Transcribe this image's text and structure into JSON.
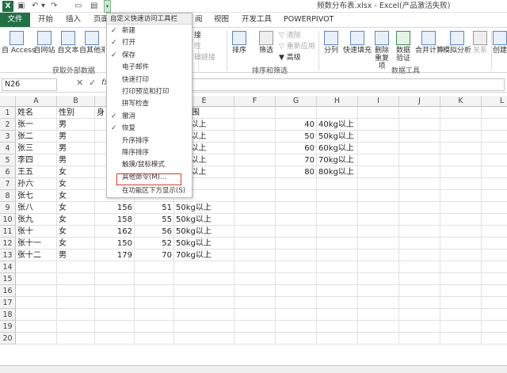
{
  "title_bar": {
    "logo": "X",
    "window_title": "频数分布表.xlsx - Excel(产品激活失败)",
    "qat_dropdown_glyph": "▾"
  },
  "tabs": [
    "文件",
    "开始",
    "插入",
    "页面",
    "阅",
    "视图",
    "开发工具",
    "POWERPIVOT"
  ],
  "ribbon": {
    "get_external": {
      "buttons": [
        "自 Access",
        "自网站",
        "自文本",
        "自其他来源"
      ],
      "group_label": "获取外部数据"
    },
    "connections": {
      "partial_labels": [
        "接",
        "性",
        "辑链接"
      ]
    },
    "sort_filter": {
      "sort": "排序",
      "filter": "筛选",
      "clear": "清除",
      "reapply": "重新应用",
      "advanced": "高级",
      "group_label": "排序和筛选"
    },
    "data_tools": {
      "buttons": [
        "分列",
        "快速填充",
        "删除重复项",
        "数据验证",
        "合并计算",
        "模拟分析",
        "关系"
      ],
      "group_label": "数据工具"
    },
    "outline": {
      "button": "创建"
    }
  },
  "formula_bar": {
    "name_box": "N26",
    "cancel": "✕",
    "enter": "✓",
    "fx": "fx"
  },
  "grid": {
    "columns": [
      "A",
      "B",
      "C",
      "D",
      "E",
      "F",
      "G",
      "H",
      "I",
      "J",
      "K",
      "L"
    ],
    "rows": [
      "1",
      "2",
      "3",
      "4",
      "5",
      "6",
      "7",
      "8",
      "9",
      "10",
      "11",
      "12",
      "13",
      "14",
      "15",
      "16",
      "17",
      "18",
      "19",
      "20"
    ],
    "cells": {
      "A": [
        "姓名",
        "张一",
        "张二",
        "张三",
        "李四",
        "王五",
        "孙六",
        "张七",
        "张八",
        "张九",
        "张十",
        "张十一",
        "张十二"
      ],
      "B": [
        "性别",
        "男",
        "男",
        "男",
        "男",
        "女",
        "女",
        "女",
        "女",
        "女",
        "女",
        "女",
        "男"
      ],
      "C": [
        "身",
        "",
        "",
        "",
        "",
        "",
        "",
        "",
        "156",
        "158",
        "162",
        "150",
        "179"
      ],
      "D": [
        "",
        "",
        "",
        "",
        "",
        "",
        "",
        "",
        "51",
        "55",
        "56",
        "52",
        "70"
      ],
      "E": [
        "重范围",
        "0kg以上",
        "0kg以上",
        "0kg以上",
        "0kg以上",
        "0kg以上",
        "",
        "",
        "50kg以上",
        "50kg以上",
        "50kg以上",
        "50kg以上",
        "70kg以上"
      ],
      "G": [
        "",
        "40",
        "50",
        "60",
        "70",
        "80"
      ],
      "H": [
        "",
        "40kg以上",
        "50kg以上",
        "60kg以上",
        "70kg以上",
        "80kg以上"
      ]
    }
  },
  "qat_menu": {
    "header": "自定义快速访问工具栏",
    "items": [
      {
        "label": "新建",
        "checked": true
      },
      {
        "label": "打开",
        "checked": true
      },
      {
        "label": "保存",
        "checked": true
      },
      {
        "label": "电子邮件",
        "checked": false
      },
      {
        "label": "快速打印",
        "checked": false
      },
      {
        "label": "打印预览和打印",
        "checked": false
      },
      {
        "label": "拼写检查",
        "checked": false
      },
      {
        "label": "撤消",
        "checked": true
      },
      {
        "label": "恢复",
        "checked": true
      },
      {
        "label": "升序排序",
        "checked": false
      },
      {
        "label": "降序排序",
        "checked": false
      },
      {
        "label": "触摸/鼠标模式",
        "checked": false
      },
      {
        "label": "其他命令(M)...",
        "checked": false
      },
      {
        "label": "在功能区下方显示(S)",
        "checked": false
      }
    ],
    "check_glyph": "✓"
  },
  "colors": {
    "excel_green": "#207245",
    "highlight_red": "#d93a2b"
  }
}
